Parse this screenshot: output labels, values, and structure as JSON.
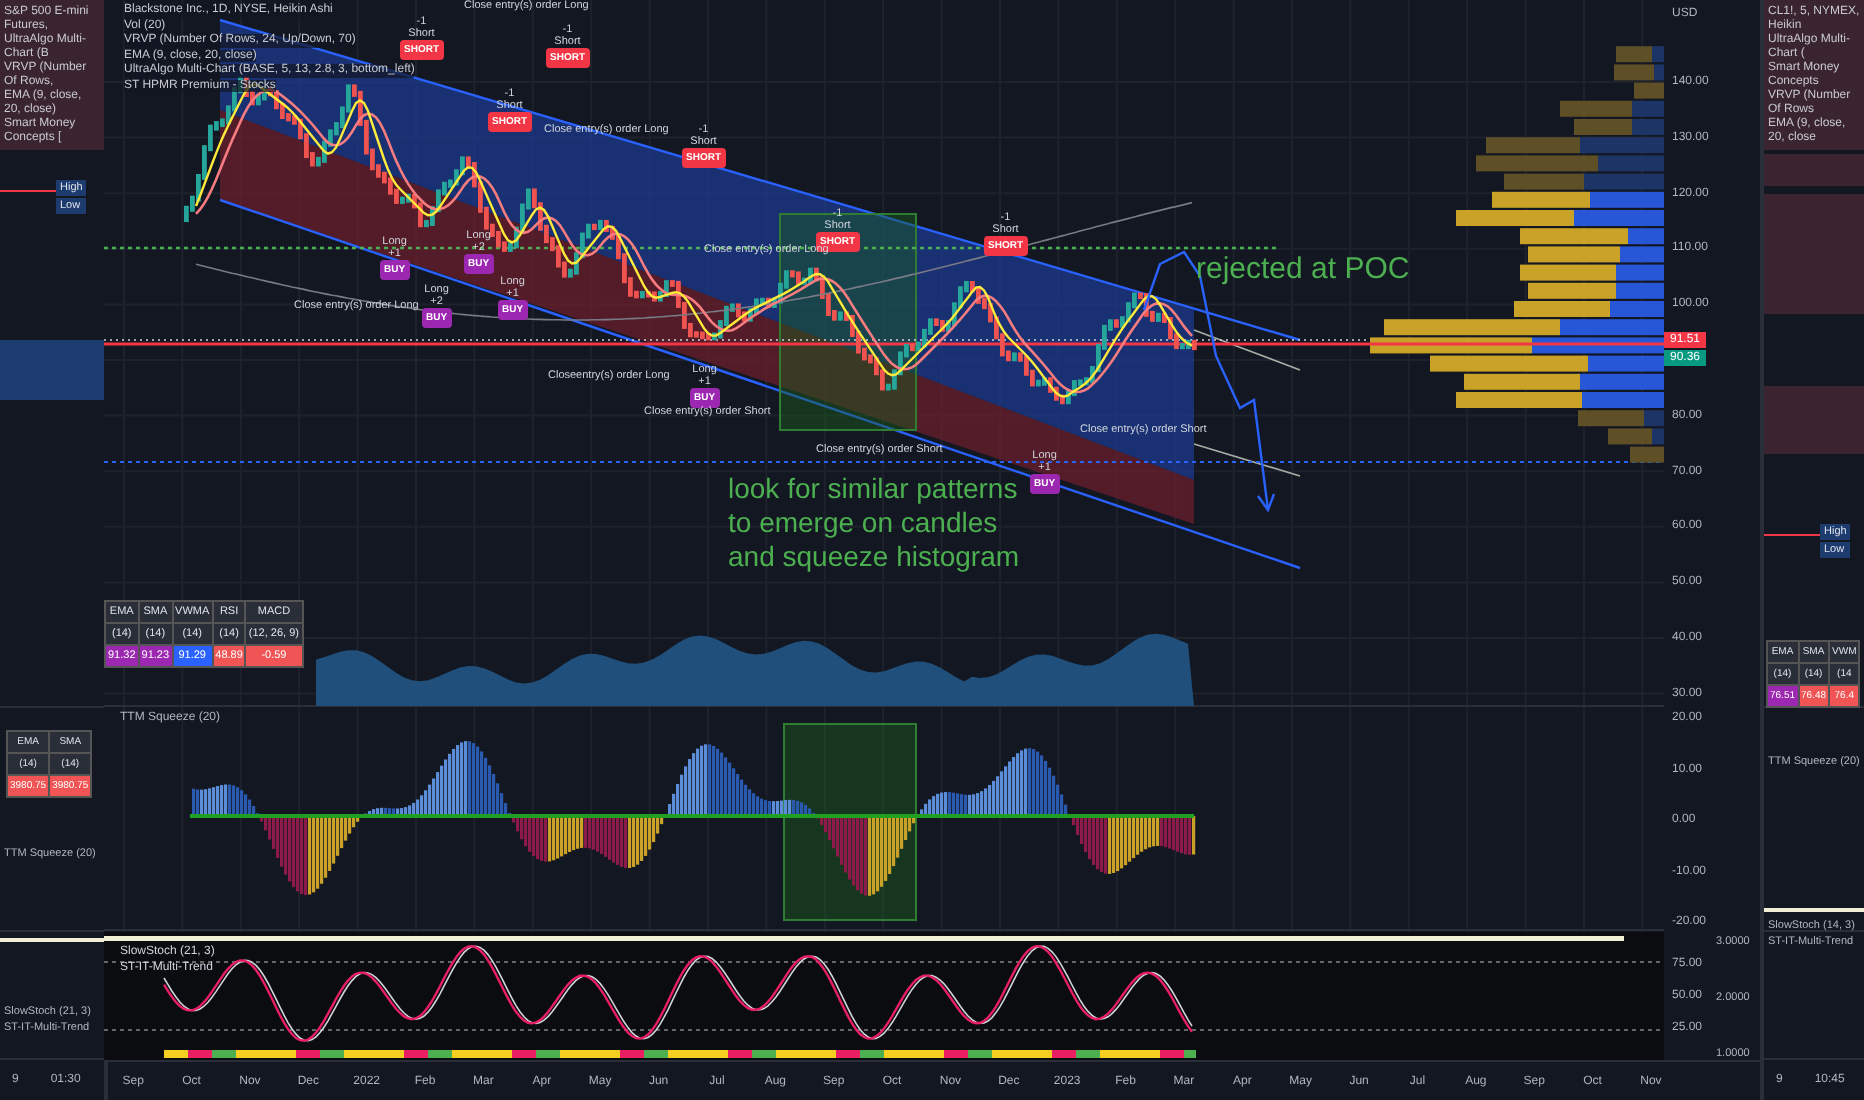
{
  "left_panel": {
    "legend": [
      "S&P 500 E-mini Futures,",
      "UltraAlgo Multi-Chart (B",
      "VRVP (Number Of Rows,",
      "EMA (9, close, 20, close)",
      "Smart Money Concepts ["
    ],
    "range_labels": [
      "High",
      "Low"
    ],
    "table": {
      "headers": [
        "EMA",
        "SMA"
      ],
      "params": [
        "(14)",
        "(14)"
      ],
      "values": [
        {
          "text": "3980.75",
          "color": "#f05454"
        },
        {
          "text": "3980.75",
          "color": "#f05454"
        }
      ]
    },
    "squeeze_label": "TTM Squeeze (20)",
    "stoch_labels": [
      "SlowStoch (21, 3)",
      "ST-IT-Multi-Trend"
    ],
    "time_labels": [
      "9",
      "01:30"
    ]
  },
  "main_chart": {
    "legend": [
      "Blackstone Inc., 1D, NYSE, Heikin Ashi",
      "Vol (20)",
      "VRVP (Number Of Rows, 24, Up/Down, 70)",
      "EMA (9, close, 20, close)",
      "UltraAlgo Multi-Chart (BASE, 5, 13, 2.8, 3, bottom_left)",
      "ST HPMR Premium - Stocks"
    ],
    "table": {
      "headers": [
        "EMA",
        "SMA",
        "VWMA",
        "RSI",
        "MACD"
      ],
      "params": [
        "(14)",
        "(14)",
        "(14)",
        "(14)",
        "(12, 26, 9)"
      ],
      "values": [
        {
          "text": "91.32",
          "color": "#9c27b0"
        },
        {
          "text": "91.23",
          "color": "#9c27b0"
        },
        {
          "text": "91.29",
          "color": "#2962ff"
        },
        {
          "text": "48.89",
          "color": "#f05454"
        },
        {
          "text": "-0.59",
          "color": "#f05454"
        }
      ]
    },
    "annotations": [
      {
        "kind": "callout",
        "text": "rejected at POC"
      },
      {
        "kind": "note",
        "text": "look for similar patterns\nto emerge on candles\nand squeeze histogram"
      }
    ],
    "signals": [
      {
        "kind": "short",
        "tag": "SHORT",
        "label": "Short",
        "note": "-1"
      },
      {
        "kind": "short",
        "tag": "SHORT",
        "label": "Short",
        "note": "-1"
      },
      {
        "kind": "short",
        "tag": "SHORT",
        "label": "Short",
        "note": "-1"
      },
      {
        "kind": "short",
        "tag": "SHORT",
        "label": "Short",
        "note": "-1"
      },
      {
        "kind": "short",
        "tag": "SHORT",
        "label": "Short",
        "note": "-1"
      },
      {
        "kind": "short",
        "tag": "SHORT",
        "label": "Short",
        "note": "-1"
      },
      {
        "kind": "long",
        "tag": "BUY",
        "label": "Long",
        "note": "+1"
      },
      {
        "kind": "long",
        "tag": "BUY",
        "label": "Long",
        "note": "+2"
      },
      {
        "kind": "long",
        "tag": "BUY",
        "label": "Long",
        "note": "+2"
      },
      {
        "kind": "long",
        "tag": "BUY",
        "label": "Long",
        "note": "+1"
      },
      {
        "kind": "long",
        "tag": "BUY",
        "label": "Long",
        "note": "+1"
      },
      {
        "kind": "long",
        "tag": "BUY",
        "label": "Long",
        "note": "+1"
      }
    ],
    "orders": [
      "Close entry(s) order Long",
      "Close entry(s) order Long",
      "Close entry(s) order Long",
      "Close entry(s) order Long",
      "Closeentry(s) order Long",
      "Close entry(s) order Short",
      "Close entry(s) order Short",
      "Close entry(s) order Short"
    ],
    "price_tags": [
      {
        "text": "91.51",
        "color": "#f23645"
      },
      {
        "text": "90.36",
        "color": "#089981"
      }
    ],
    "squeeze_label": "TTM Squeeze (20)",
    "stoch_labels": [
      "SlowStoch (21, 3)",
      "ST-IT-Multi-Trend"
    ]
  },
  "price_axis": {
    "currency": "USD",
    "main_ticks": [
      "140.00",
      "130.00",
      "120.00",
      "110.00",
      "100.00",
      "80.00",
      "70.00",
      "60.00",
      "50.00",
      "40.00",
      "30.00"
    ],
    "squeeze_ticks": [
      "20.00",
      "10.00",
      "0.00",
      "-10.00",
      "-20.00"
    ],
    "stoch_ticks": [
      "75.00",
      "50.00",
      "25.00"
    ],
    "trend_ticks": [
      "3.0000",
      "2.0000",
      "1.0000"
    ]
  },
  "time_axis": {
    "labels": [
      "Sep",
      "Oct",
      "Nov",
      "Dec",
      "2022",
      "Feb",
      "Mar",
      "Apr",
      "May",
      "Jun",
      "Jul",
      "Aug",
      "Sep",
      "Oct",
      "Nov",
      "Dec",
      "2023",
      "Feb",
      "Mar",
      "Apr",
      "May",
      "Jun",
      "Jul",
      "Aug",
      "Sep",
      "Oct",
      "Nov"
    ]
  },
  "right_panel": {
    "legend": [
      "CL1!, 5, NYMEX, Heikin",
      "UltraAlgo Multi-Chart (",
      "Smart Money Concepts",
      "VRVP (Number Of Rows",
      "EMA (9, close, 20, close"
    ],
    "range_labels": [
      "High",
      "Low"
    ],
    "table": {
      "headers": [
        "EMA",
        "SMA",
        "VWM"
      ],
      "params": [
        "(14)",
        "(14)",
        "(14"
      ],
      "values": [
        {
          "text": "76.51",
          "color": "#9c27b0"
        },
        {
          "text": "76.48",
          "color": "#f05454"
        },
        {
          "text": "76.4",
          "color": "#f05454"
        }
      ]
    },
    "squeeze_label": "TTM Squeeze (20)",
    "stoch_labels": [
      "SlowStoch (14, 3)",
      "ST-IT-Multi-Trend"
    ],
    "time_labels": [
      "9",
      "10:45"
    ]
  }
}
